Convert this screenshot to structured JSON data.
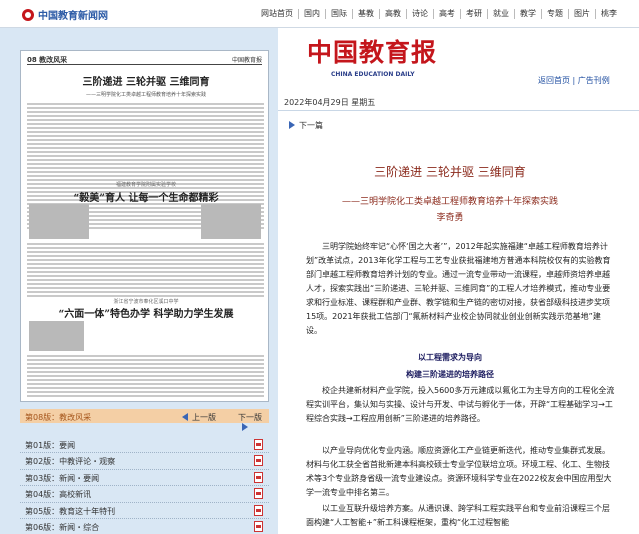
{
  "site": {
    "logo_text": "中国教育新闻网",
    "nav": [
      "网站首页",
      "国内",
      "国际",
      "基教",
      "高教",
      "诗论",
      "高考",
      "考研",
      "就业",
      "教学",
      "专题",
      "图片",
      "桃李"
    ]
  },
  "paper": {
    "page_label": "08 教改风采",
    "paper_name": "中国教育报",
    "headline": "三阶递进 三轮并驱 三维同育",
    "headline_sub": "——三明学院化工类卓越工程师教育培养十年探索实践",
    "article2_sub": "福建教育学院附属实验学校",
    "article2_title": "“毅美”育人 让每一个生命都精彩",
    "article3_sub": "浙江省宁波市奉化区溪口中学",
    "article3_title": "“六面一体”特色办学 科学助力学生发展"
  },
  "pager": {
    "current": "第08版：教改风采",
    "prev": "上一版",
    "next": "下一版"
  },
  "editions": [
    "第01版：要闻",
    "第02版：中教评论・观察",
    "第03版：新闻・要闻",
    "第04版：高校新讯",
    "第05版：教育这十年特刊",
    "第06版：新闻・综合"
  ],
  "masthead": {
    "title": "中国教育报",
    "english": "CHINA EDUCATION DAILY"
  },
  "links": {
    "home": "返回首页",
    "divider": "|",
    "ads": "广告刊例"
  },
  "date": "2022年04月29日 星期五",
  "next_article": "下一篇",
  "article": {
    "title": "三阶递进 三轮并驱 三维同育",
    "subtitle": "——三明学院化工类卓越工程师教育培养十年探索实践",
    "author": "李奇勇",
    "p1": "三明学院始终牢记“心怀‘国之大者’”，2012年起实施福建“卓越工程师教育培养计划”改革试点，2013年化学工程与工艺专业获批福建地方普通本科院校仅有的实验教育部门卓越工程师教育培养计划的专业。通过一流专业带动一流课程，卓越师资培养卓越人才，探索实践出“三阶递进、三轮并驱、三维同育”的工程人才培养模式，推动专业要求和行业标准、课程群和产业群、教学链和生产链的密切对接，获省部级科技进步奖项15项。2021年获批工信部门“氟新材料产业校企协同就业创业创新实践示范基地”建设。",
    "section1_title": "以工程需求为导向",
    "section1_sub": "构建三阶递进的培养路径",
    "p2": "校企共建新材料产业学院，投入5600多万元建成以氟化工为主导方向的工程化全流程实训平台，集认知与实操、设计与开发、中试与孵化于一体，开辟“工程基础学习→工程综合实践→工程应用创新”三阶递进的培养路径。",
    "p3": "以产业导向优化专业内涵。顺应资源化工产业链更新迭代，推动专业集群式发展。材料与化工获全省首批新建本科高校硕士专业学位联培立项。环境工程、化工、生物技术等3个专业跻身省级一流专业建设点。资源环境科学专业在2022校友会中国应用型大学一流专业中排名第三。",
    "p4": "以工业互联升级培养方案。从通识课、跨学科工程实践平台和专业前沿课程三个层面构建“人工智能+”新工科课程框架，重构“化工过程智能"
  }
}
